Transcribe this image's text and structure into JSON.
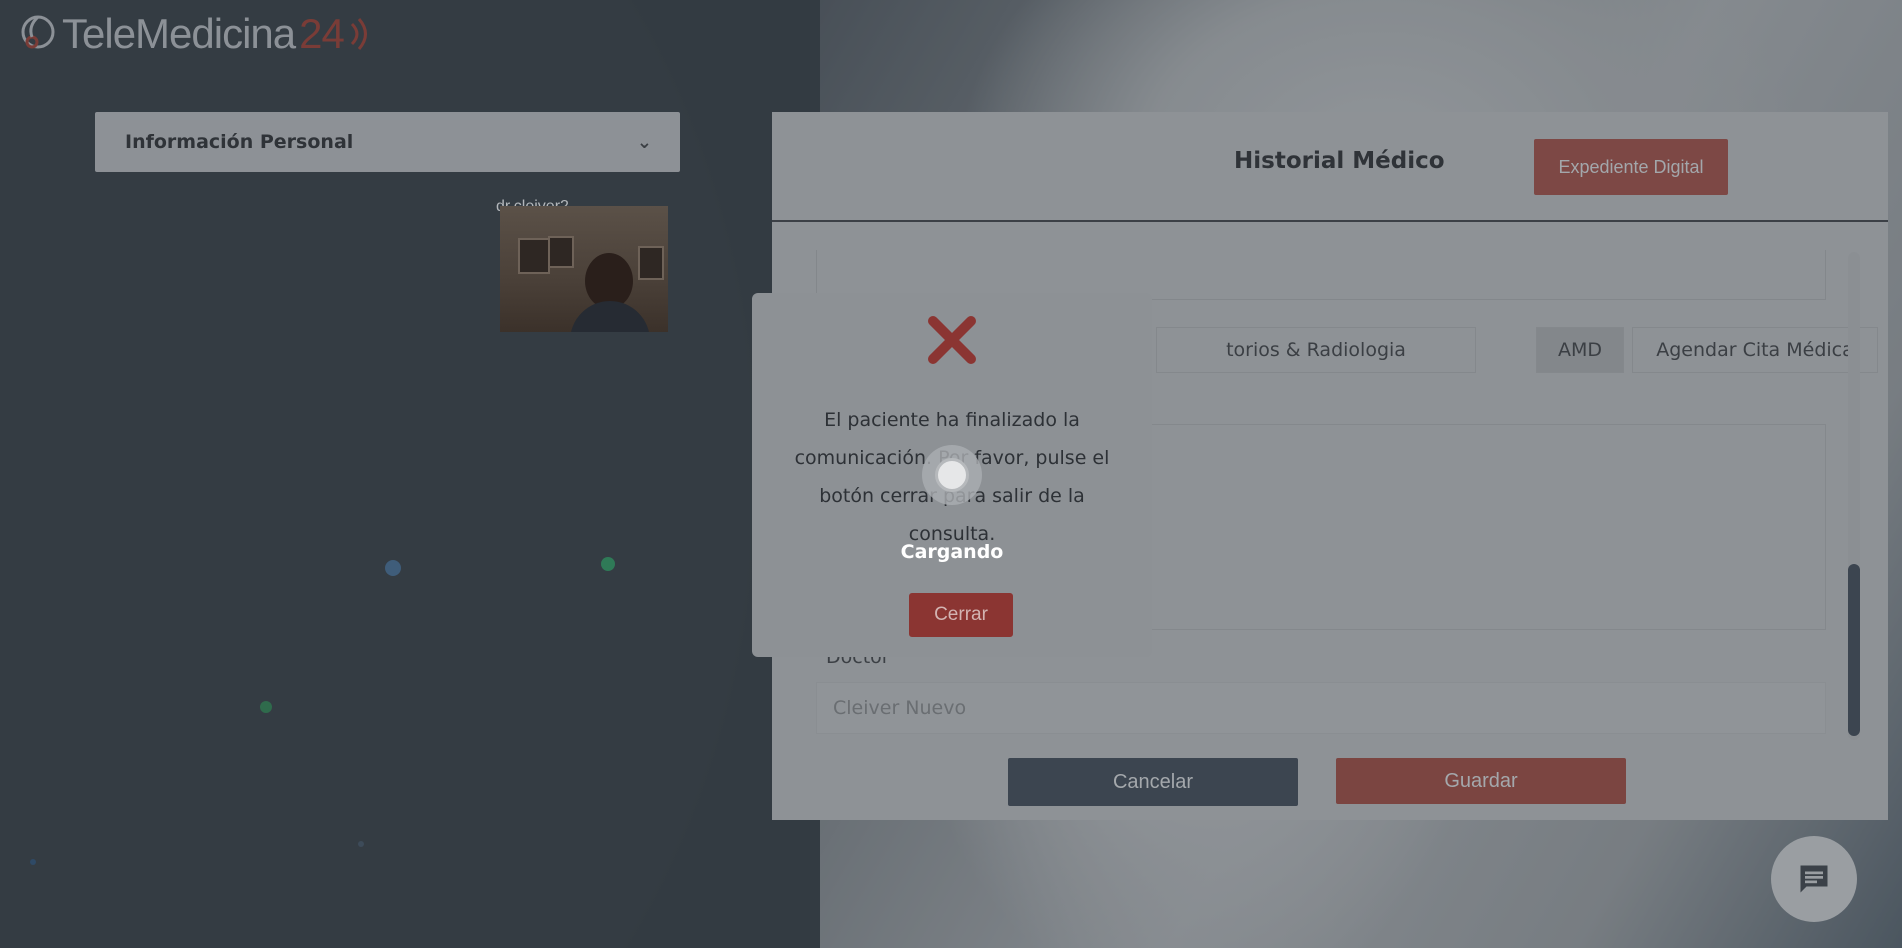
{
  "app": {
    "logo_text": "TeleMedicina",
    "logo_number": "24"
  },
  "sidebar": {
    "personal_info_label": "Información Personal"
  },
  "video": {
    "participant_name": "dr.cleiver2"
  },
  "panel": {
    "title": "Historial Médico",
    "expediente_button": "Expediente Digital",
    "tabs": [
      {
        "label": "torios & Radiologia"
      },
      {
        "label": "AMD"
      },
      {
        "label": "Agendar Cita Médica"
      }
    ],
    "doctor_label": "Doctor",
    "doctor_value": "Cleiver Nuevo",
    "cancel_button": "Cancelar",
    "save_button": "Guardar"
  },
  "modal": {
    "message": "El paciente ha finalizado la comunicación. Por favor, pulse el botón cerrar para salir de la consulta.",
    "loading_text": "Cargando",
    "close_button": "Cerrar"
  },
  "icons": {
    "logo": "stethoscope-icon",
    "dropdown": "chevron-down-icon",
    "error": "close-x-icon",
    "chat": "chat-icon",
    "spinner": "loading-spinner-icon"
  },
  "colors": {
    "accent_red": "#c0392b",
    "dark_button": "#2c3e50"
  }
}
